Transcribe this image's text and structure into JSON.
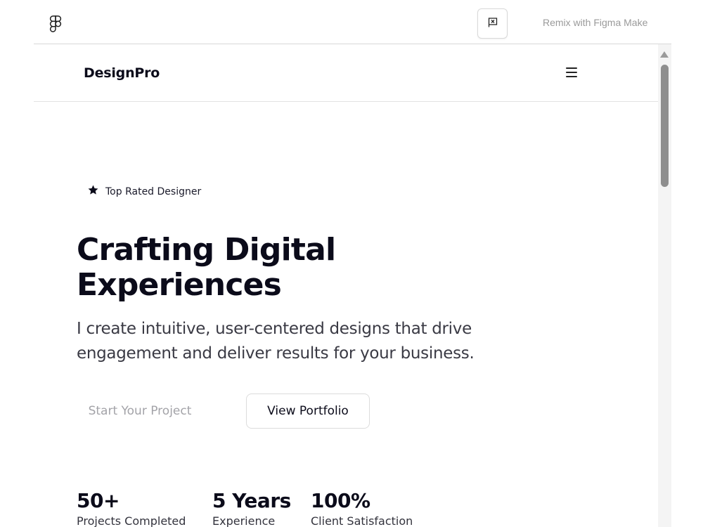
{
  "viewer": {
    "logo_icon": "figma-logo-icon",
    "report_icon": "flag-report-icon",
    "remix_label": "Remix with Figma Make"
  },
  "nav": {
    "brand": "DesignPro",
    "menu_icon": "hamburger-menu-icon"
  },
  "hero": {
    "badge_icon": "star-icon",
    "badge": "Top Rated Designer",
    "title_line1": "Crafting Digital",
    "title_line2": "Experiences",
    "subtitle_line1": "I create intuitive, user-centered designs that drive",
    "subtitle_line2": "engagement and deliver results for your business.",
    "primary_cta": "Start Your Project",
    "secondary_cta": "View Portfolio"
  },
  "stats": [
    {
      "value": "50+",
      "label": "Projects Completed"
    },
    {
      "value": "5 Years",
      "label": "Experience"
    },
    {
      "value": "100%",
      "label": "Client Satisfaction"
    }
  ],
  "colors": {
    "text_primary": "#0b0b1a",
    "text_muted": "#a3a3a8",
    "border": "#dcdcdc",
    "scroll_thumb": "#8e8e8e"
  }
}
